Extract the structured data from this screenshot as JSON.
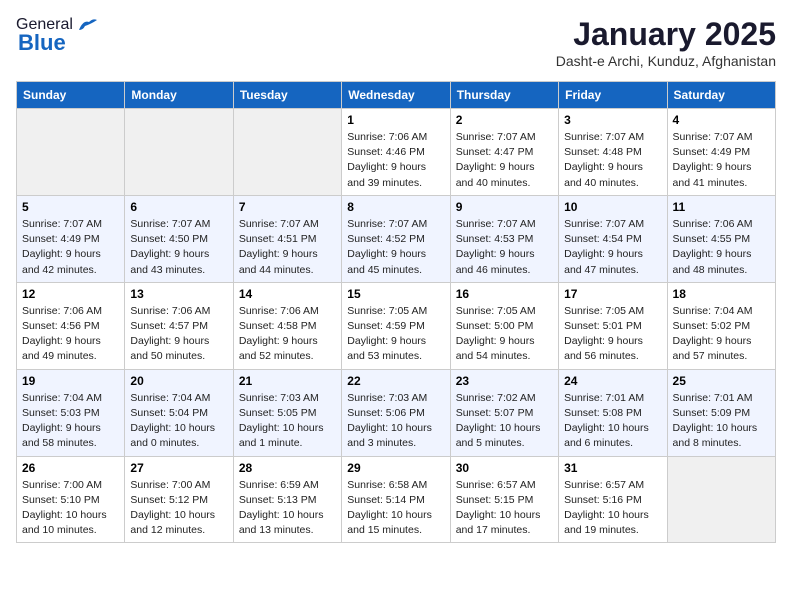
{
  "header": {
    "logo_general": "General",
    "logo_blue": "Blue",
    "title": "January 2025",
    "subtitle": "Dasht-e Archi, Kunduz, Afghanistan"
  },
  "calendar": {
    "days": [
      "Sunday",
      "Monday",
      "Tuesday",
      "Wednesday",
      "Thursday",
      "Friday",
      "Saturday"
    ],
    "weeks": [
      [
        {
          "date": "",
          "text": ""
        },
        {
          "date": "",
          "text": ""
        },
        {
          "date": "",
          "text": ""
        },
        {
          "date": "1",
          "text": "Sunrise: 7:06 AM\nSunset: 4:46 PM\nDaylight: 9 hours\nand 39 minutes."
        },
        {
          "date": "2",
          "text": "Sunrise: 7:07 AM\nSunset: 4:47 PM\nDaylight: 9 hours\nand 40 minutes."
        },
        {
          "date": "3",
          "text": "Sunrise: 7:07 AM\nSunset: 4:48 PM\nDaylight: 9 hours\nand 40 minutes."
        },
        {
          "date": "4",
          "text": "Sunrise: 7:07 AM\nSunset: 4:49 PM\nDaylight: 9 hours\nand 41 minutes."
        }
      ],
      [
        {
          "date": "5",
          "text": "Sunrise: 7:07 AM\nSunset: 4:49 PM\nDaylight: 9 hours\nand 42 minutes."
        },
        {
          "date": "6",
          "text": "Sunrise: 7:07 AM\nSunset: 4:50 PM\nDaylight: 9 hours\nand 43 minutes."
        },
        {
          "date": "7",
          "text": "Sunrise: 7:07 AM\nSunset: 4:51 PM\nDaylight: 9 hours\nand 44 minutes."
        },
        {
          "date": "8",
          "text": "Sunrise: 7:07 AM\nSunset: 4:52 PM\nDaylight: 9 hours\nand 45 minutes."
        },
        {
          "date": "9",
          "text": "Sunrise: 7:07 AM\nSunset: 4:53 PM\nDaylight: 9 hours\nand 46 minutes."
        },
        {
          "date": "10",
          "text": "Sunrise: 7:07 AM\nSunset: 4:54 PM\nDaylight: 9 hours\nand 47 minutes."
        },
        {
          "date": "11",
          "text": "Sunrise: 7:06 AM\nSunset: 4:55 PM\nDaylight: 9 hours\nand 48 minutes."
        }
      ],
      [
        {
          "date": "12",
          "text": "Sunrise: 7:06 AM\nSunset: 4:56 PM\nDaylight: 9 hours\nand 49 minutes."
        },
        {
          "date": "13",
          "text": "Sunrise: 7:06 AM\nSunset: 4:57 PM\nDaylight: 9 hours\nand 50 minutes."
        },
        {
          "date": "14",
          "text": "Sunrise: 7:06 AM\nSunset: 4:58 PM\nDaylight: 9 hours\nand 52 minutes."
        },
        {
          "date": "15",
          "text": "Sunrise: 7:05 AM\nSunset: 4:59 PM\nDaylight: 9 hours\nand 53 minutes."
        },
        {
          "date": "16",
          "text": "Sunrise: 7:05 AM\nSunset: 5:00 PM\nDaylight: 9 hours\nand 54 minutes."
        },
        {
          "date": "17",
          "text": "Sunrise: 7:05 AM\nSunset: 5:01 PM\nDaylight: 9 hours\nand 56 minutes."
        },
        {
          "date": "18",
          "text": "Sunrise: 7:04 AM\nSunset: 5:02 PM\nDaylight: 9 hours\nand 57 minutes."
        }
      ],
      [
        {
          "date": "19",
          "text": "Sunrise: 7:04 AM\nSunset: 5:03 PM\nDaylight: 9 hours\nand 58 minutes."
        },
        {
          "date": "20",
          "text": "Sunrise: 7:04 AM\nSunset: 5:04 PM\nDaylight: 10 hours\nand 0 minutes."
        },
        {
          "date": "21",
          "text": "Sunrise: 7:03 AM\nSunset: 5:05 PM\nDaylight: 10 hours\nand 1 minute."
        },
        {
          "date": "22",
          "text": "Sunrise: 7:03 AM\nSunset: 5:06 PM\nDaylight: 10 hours\nand 3 minutes."
        },
        {
          "date": "23",
          "text": "Sunrise: 7:02 AM\nSunset: 5:07 PM\nDaylight: 10 hours\nand 5 minutes."
        },
        {
          "date": "24",
          "text": "Sunrise: 7:01 AM\nSunset: 5:08 PM\nDaylight: 10 hours\nand 6 minutes."
        },
        {
          "date": "25",
          "text": "Sunrise: 7:01 AM\nSunset: 5:09 PM\nDaylight: 10 hours\nand 8 minutes."
        }
      ],
      [
        {
          "date": "26",
          "text": "Sunrise: 7:00 AM\nSunset: 5:10 PM\nDaylight: 10 hours\nand 10 minutes."
        },
        {
          "date": "27",
          "text": "Sunrise: 7:00 AM\nSunset: 5:12 PM\nDaylight: 10 hours\nand 12 minutes."
        },
        {
          "date": "28",
          "text": "Sunrise: 6:59 AM\nSunset: 5:13 PM\nDaylight: 10 hours\nand 13 minutes."
        },
        {
          "date": "29",
          "text": "Sunrise: 6:58 AM\nSunset: 5:14 PM\nDaylight: 10 hours\nand 15 minutes."
        },
        {
          "date": "30",
          "text": "Sunrise: 6:57 AM\nSunset: 5:15 PM\nDaylight: 10 hours\nand 17 minutes."
        },
        {
          "date": "31",
          "text": "Sunrise: 6:57 AM\nSunset: 5:16 PM\nDaylight: 10 hours\nand 19 minutes."
        },
        {
          "date": "",
          "text": ""
        }
      ]
    ]
  }
}
